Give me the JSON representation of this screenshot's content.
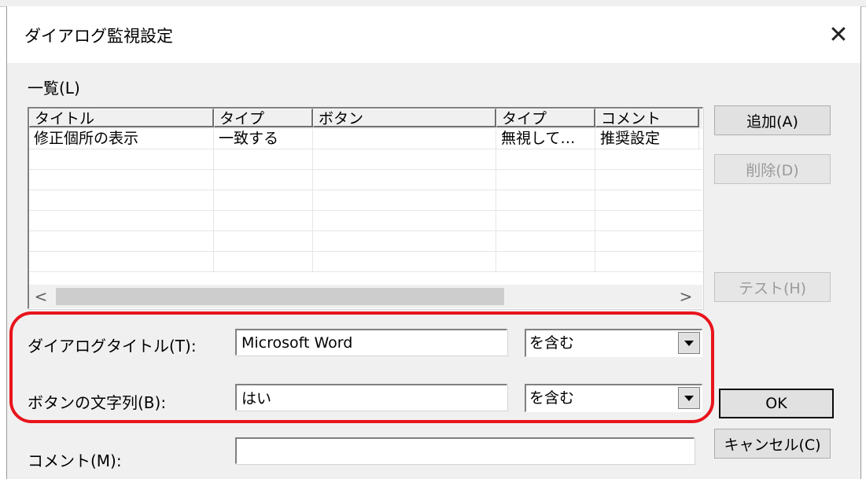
{
  "window": {
    "title": "ダイアログ監視設定",
    "close_glyph": "✕"
  },
  "list": {
    "label": "一覧(L)",
    "columns": [
      "タイトル",
      "タイプ",
      "ボタン",
      "タイプ",
      "コメント"
    ],
    "rows": [
      [
        "修正個所の表示",
        "一致する",
        "",
        "無視して…",
        "推奨設定"
      ]
    ],
    "scroll_left": "<",
    "scroll_right": ">"
  },
  "buttons": {
    "add": "追加(A)",
    "delete": "削除(D)",
    "test": "テスト(H)",
    "ok": "OK",
    "cancel": "キャンセル(C)"
  },
  "form": {
    "dialog_title_label": "ダイアログタイトル(T):",
    "dialog_title_value": "Microsoft Word",
    "dialog_title_match": "を含む",
    "button_text_label": "ボタンの文字列(B):",
    "button_text_value": "はい",
    "button_text_match": "を含む",
    "comment_label": "コメント(M):",
    "comment_value": ""
  },
  "colors": {
    "highlight": "#e8141c",
    "dialog_bg": "#f0f0f0"
  }
}
